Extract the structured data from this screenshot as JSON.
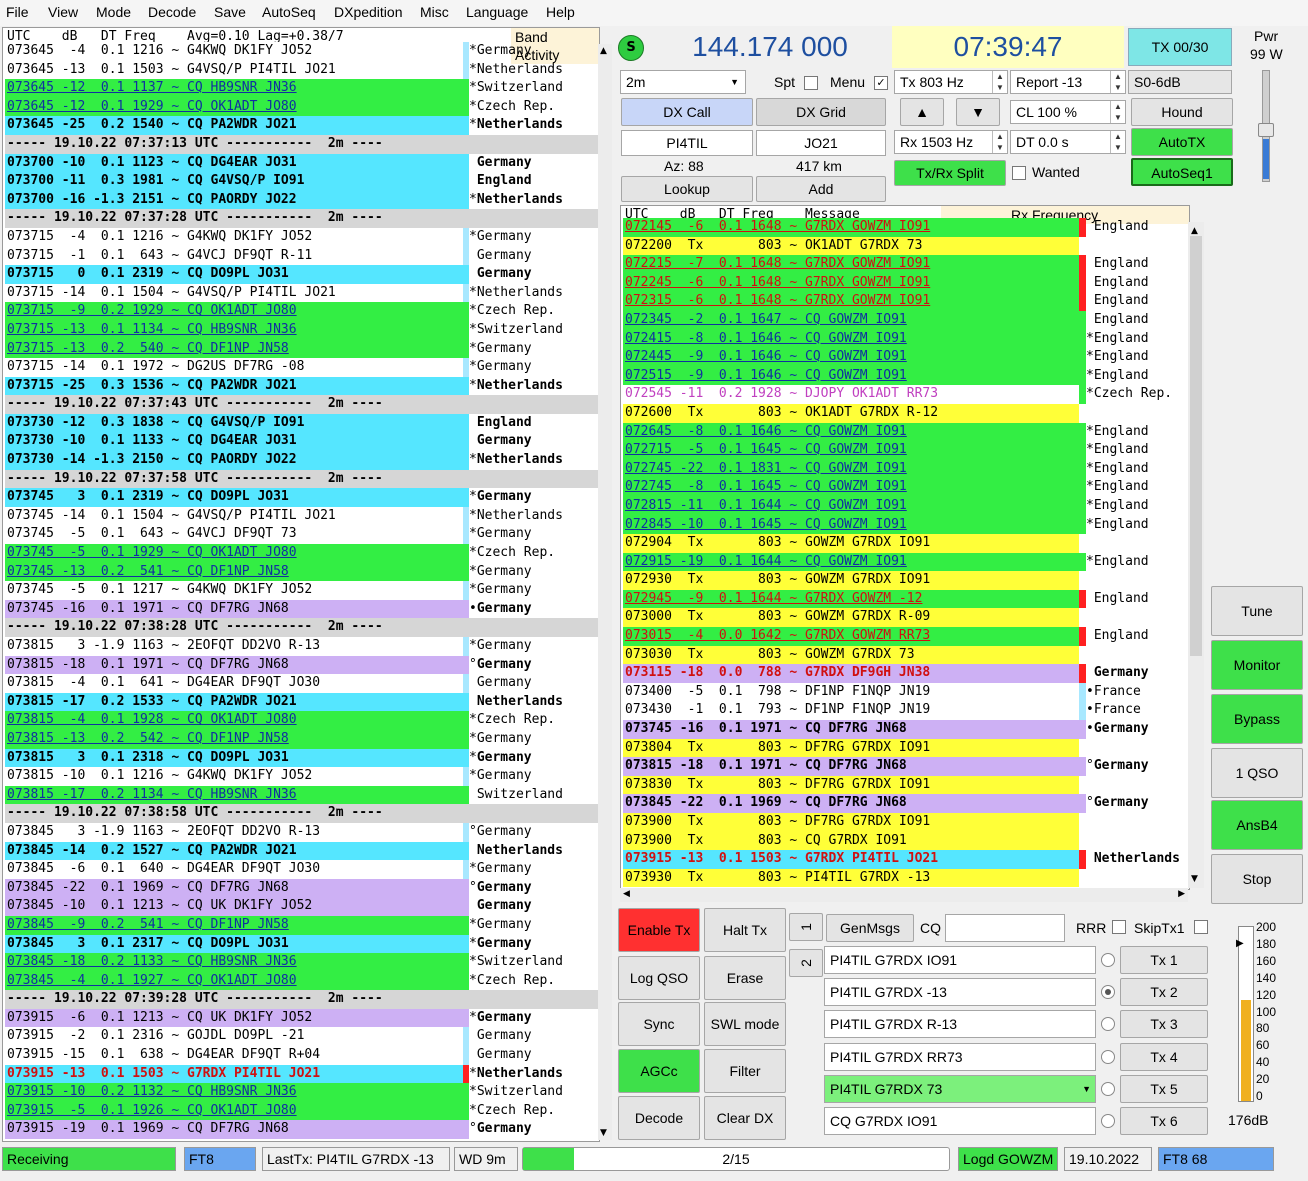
{
  "menu": [
    "File",
    "View",
    "Mode",
    "Decode",
    "Save",
    "AutoSeq",
    "DXpedition",
    "Misc",
    "Language",
    "Help"
  ],
  "colors": {
    "green": "#33ee44",
    "cyan": "#55e6ff",
    "purple": "#cdb0f4",
    "yellow": "#ffff38",
    "grayhdr": "#d6d6d6",
    "red": "#ff2020",
    "white": "#ffffff"
  },
  "band": {
    "header": "UTC    dB   DT Freq    Avg=0.10 Lag=+0.38/7",
    "title": "Band Activity",
    "rows": [
      [
        "073645  -4  0.1 1216 ~ G4KWQ DK1FY JO52",
        "Germany",
        "w",
        "*"
      ],
      [
        "073645 -13  0.1 1503 ~ G4VSQ/P PI4TIL JO21",
        "Netherlands",
        "w",
        "*"
      ],
      [
        "073645 -12  0.1 1137 ~ CQ HB9SNR JN36",
        "Switzerland",
        "g",
        "*"
      ],
      [
        "073645 -12  0.1 1929 ~ CQ OK1ADT JO80",
        "Czech Rep.",
        "g",
        "*"
      ],
      [
        "073645 -25  0.2 1540 ~ CQ PA2WDR JO21",
        "Netherlands",
        "c",
        "*"
      ],
      [
        "----- 19.10.22 07:37:13 UTC -----------  2m ----",
        "",
        "h",
        ""
      ],
      [
        "073700 -10  0.1 1123 ~ CQ DG4EAR JO31",
        "Germany",
        "c",
        " "
      ],
      [
        "073700 -11  0.3 1981 ~ CQ G4VSQ/P IO91",
        "England",
        "c",
        " "
      ],
      [
        "073700 -16 -1.3 2151 ~ CQ PAORDY JO22",
        "Netherlands",
        "c",
        "*"
      ],
      [
        "----- 19.10.22 07:37:28 UTC -----------  2m ----",
        "",
        "h",
        ""
      ],
      [
        "073715  -4  0.1 1216 ~ G4KWQ DK1FY JO52",
        "Germany",
        "w",
        "*"
      ],
      [
        "073715  -1  0.1  643 ~ G4VCJ DF9QT R-11",
        "Germany",
        "w",
        " "
      ],
      [
        "073715   0  0.1 2319 ~ CQ DO9PL JO31",
        "Germany",
        "c",
        " "
      ],
      [
        "073715 -14  0.1 1504 ~ G4VSQ/P PI4TIL JO21",
        "Netherlands",
        "w",
        "*"
      ],
      [
        "073715  -9  0.2 1929 ~ CQ OK1ADT JO80",
        "Czech Rep.",
        "g",
        "*"
      ],
      [
        "073715 -13  0.1 1134 ~ CQ HB9SNR JN36",
        "Switzerland",
        "g",
        "*"
      ],
      [
        "073715 -13  0.2  540 ~ CQ DF1NP JN58",
        "Germany",
        "g",
        "*"
      ],
      [
        "073715 -14  0.1 1972 ~ DG2US DF7RG -08",
        "Germany",
        "w",
        "*"
      ],
      [
        "073715 -25  0.3 1536 ~ CQ PA2WDR JO21",
        "Netherlands",
        "c",
        "*"
      ],
      [
        "----- 19.10.22 07:37:43 UTC -----------  2m ----",
        "",
        "h",
        ""
      ],
      [
        "073730 -12  0.3 1838 ~ CQ G4VSQ/P IO91",
        "England",
        "c",
        " "
      ],
      [
        "073730 -10  0.1 1133 ~ CQ DG4EAR JO31",
        "Germany",
        "c",
        " "
      ],
      [
        "073730 -14 -1.3 2150 ~ CQ PAORDY JO22",
        "Netherlands",
        "c",
        "*"
      ],
      [
        "----- 19.10.22 07:37:58 UTC -----------  2m ----",
        "",
        "h",
        ""
      ],
      [
        "073745   3  0.1 2319 ~ CQ DO9PL JO31",
        "Germany",
        "c",
        "*"
      ],
      [
        "073745 -14  0.1 1504 ~ G4VSQ/P PI4TIL JO21",
        "Netherlands",
        "w",
        "*"
      ],
      [
        "073745  -5  0.1  643 ~ G4VCJ DF9QT 73",
        "Germany",
        "w",
        "*"
      ],
      [
        "073745  -5  0.1 1929 ~ CQ OK1ADT JO80",
        "Czech Rep.",
        "g",
        "*"
      ],
      [
        "073745 -13  0.2  541 ~ CQ DF1NP JN58",
        "Germany",
        "g",
        "*"
      ],
      [
        "073745  -5  0.1 1217 ~ G4KWQ DK1FY JO52",
        "Germany",
        "w",
        "*"
      ],
      [
        "073745 -16  0.1 1971 ~ CQ DF7RG JN68",
        "Germany",
        "p",
        "•"
      ],
      [
        "----- 19.10.22 07:38:28 UTC -----------  2m ----",
        "",
        "h",
        ""
      ],
      [
        "073815   3 -1.9 1163 ~ 2EOFQT DD2VO R-13",
        "Germany",
        "w",
        "*"
      ],
      [
        "073815 -18  0.1 1971 ~ CQ DF7RG JN68",
        "Germany",
        "p",
        "°"
      ],
      [
        "073815  -4  0.1  641 ~ DG4EAR DF9QT JO30",
        "Germany",
        "w",
        " "
      ],
      [
        "073815 -17  0.2 1533 ~ CQ PA2WDR JO21",
        "Netherlands",
        "c",
        " "
      ],
      [
        "073815  -4  0.1 1928 ~ CQ OK1ADT JO80",
        "Czech Rep.",
        "g",
        "*"
      ],
      [
        "073815 -13  0.2  542 ~ CQ DF1NP JN58",
        "Germany",
        "g",
        "*"
      ],
      [
        "073815   3  0.1 2318 ~ CQ DO9PL JO31",
        "Germany",
        "c",
        "*"
      ],
      [
        "073815 -10  0.1 1216 ~ G4KWQ DK1FY JO52",
        "Germany",
        "w",
        "*"
      ],
      [
        "073815 -17  0.2 1134 ~ CQ HB9SNR JN36",
        "Switzerland",
        "g",
        " "
      ],
      [
        "----- 19.10.22 07:38:58 UTC -----------  2m ----",
        "",
        "h",
        ""
      ],
      [
        "073845   3 -1.9 1163 ~ 2EOFQT DD2VO R-13",
        "Germany",
        "w",
        "°"
      ],
      [
        "073845 -14  0.2 1527 ~ CQ PA2WDR JO21",
        "Netherlands",
        "c",
        " "
      ],
      [
        "073845  -6  0.1  640 ~ DG4EAR DF9QT JO30",
        "Germany",
        "w",
        "*"
      ],
      [
        "073845 -22  0.1 1969 ~ CQ DF7RG JN68",
        "Germany",
        "p",
        "°"
      ],
      [
        "073845 -10  0.1 1213 ~ CQ UK DK1FY JO52",
        "Germany",
        "p",
        " "
      ],
      [
        "073845  -9  0.2  541 ~ CQ DF1NP JN58",
        "Germany",
        "g",
        "*"
      ],
      [
        "073845   3  0.1 2317 ~ CQ DO9PL JO31",
        "Germany",
        "c",
        "*"
      ],
      [
        "073845 -18  0.2 1133 ~ CQ HB9SNR JN36",
        "Switzerland",
        "g",
        "*"
      ],
      [
        "073845  -4  0.1 1927 ~ CQ OK1ADT JO80",
        "Czech Rep.",
        "g",
        "*"
      ],
      [
        "----- 19.10.22 07:39:28 UTC -----------  2m ----",
        "",
        "h",
        ""
      ],
      [
        "073915  -6  0.1 1213 ~ CQ UK DK1FY JO52",
        "Germany",
        "p",
        "*"
      ],
      [
        "073915  -2  0.1 2316 ~ GOJDL DO9PL -21",
        "Germany",
        "w",
        " "
      ],
      [
        "073915 -15  0.1  638 ~ DG4EAR DF9QT R+04",
        "Germany",
        "w",
        " "
      ],
      [
        "073915 -13  0.1 1503 ~ G7RDX PI4TIL JO21",
        "Netherlands",
        "c",
        "*"
      ],
      [
        "073915 -10  0.2 1132 ~ CQ HB9SNR JN36",
        "Switzerland",
        "g",
        "*"
      ],
      [
        "073915  -5  0.1 1926 ~ CQ OK1ADT JO80",
        "Czech Rep.",
        "g",
        "*"
      ],
      [
        "073915 -19  0.1 1969 ~ CQ DF7RG JN68",
        "Germany",
        "p",
        "°"
      ]
    ]
  },
  "top": {
    "s_icon": "S",
    "freq": "144.174 000",
    "clock": "07:39:47",
    "tx_count": "TX 00/30",
    "pwr_label": "Pwr",
    "pwr_value": "99 W",
    "band": "2m",
    "spt": "Spt",
    "menu_chk": "Menu",
    "tx_hz": "Tx  803  Hz",
    "report": "Report -13",
    "s0": "S0-6dB",
    "dxcall_label": "DX Call",
    "dxgrid_label": "DX Grid",
    "up": "▲",
    "down": "▼",
    "cl": "CL  100 %",
    "hound": "Hound",
    "dxcall": "PI4TIL",
    "dxgrid": "JO21",
    "rx_hz": "Rx  1503  Hz",
    "dt": "DT 0.0 s",
    "autotx": "AutoTX",
    "az": "Az: 88",
    "km": "417 km",
    "txrx": "Tx/Rx Split",
    "wanted": "Wanted",
    "autoseq": "AutoSeq1",
    "lookup": "Lookup",
    "add": "Add"
  },
  "rx": {
    "header": "UTC    dB   DT Freq    Message",
    "title": "Rx Frequency",
    "rows": [
      [
        "072145  -6  0.1 1648 ~ G7RDX GOWZM IO91",
        "England",
        "g",
        "r"
      ],
      [
        "072200  Tx       803 ~ OK1ADT G7RDX 73",
        "",
        "y",
        ""
      ],
      [
        "072215  -7  0.1 1648 ~ G7RDX GOWZM IO91",
        "England",
        "g",
        "r"
      ],
      [
        "072245  -6  0.1 1648 ~ G7RDX GOWZM IO91",
        "England",
        "g",
        "r"
      ],
      [
        "072315  -6  0.1 1648 ~ G7RDX GOWZM IO91",
        "England",
        "g",
        "r"
      ],
      [
        "072345  -2  0.1 1647 ~ CQ GOWZM IO91",
        "England",
        "g",
        " "
      ],
      [
        "072415  -8  0.1 1646 ~ CQ GOWZM IO91",
        "England",
        "g",
        "*"
      ],
      [
        "072445  -9  0.1 1646 ~ CQ GOWZM IO91",
        "England",
        "g",
        "*"
      ],
      [
        "072515  -9  0.1 1646 ~ CQ GOWZM IO91",
        "England",
        "g",
        "*"
      ],
      [
        "072545 -11  0.2 1928 ~ DJOPY OK1ADT RR73",
        "Czech Rep.",
        "m",
        "*"
      ],
      [
        "072600  Tx       803 ~ OK1ADT G7RDX R-12",
        "",
        "y",
        ""
      ],
      [
        "072645  -8  0.1 1646 ~ CQ GOWZM IO91",
        "England",
        "g",
        "*"
      ],
      [
        "072715  -5  0.1 1645 ~ CQ GOWZM IO91",
        "England",
        "g",
        "*"
      ],
      [
        "072745 -22  0.1 1831 ~ CQ GOWZM IO91",
        "England",
        "g",
        "*"
      ],
      [
        "072745  -8  0.1 1645 ~ CQ GOWZM IO91",
        "England",
        "g",
        "*"
      ],
      [
        "072815 -11  0.1 1644 ~ CQ GOWZM IO91",
        "England",
        "g",
        "*"
      ],
      [
        "072845 -10  0.1 1645 ~ CQ GOWZM IO91",
        "England",
        "g",
        "*"
      ],
      [
        "072904  Tx       803 ~ GOWZM G7RDX IO91",
        "",
        "y",
        ""
      ],
      [
        "072915 -19  0.1 1644 ~ CQ GOWZM IO91",
        "England",
        "g",
        "*"
      ],
      [
        "072930  Tx       803 ~ GOWZM G7RDX IO91",
        "",
        "y",
        ""
      ],
      [
        "072945  -9  0.1 1644 ~ G7RDX GOWZM -12",
        "England",
        "g",
        "r"
      ],
      [
        "073000  Tx       803 ~ GOWZM G7RDX R-09",
        "",
        "y",
        ""
      ],
      [
        "073015  -4  0.0 1642 ~ G7RDX GOWZM RR73",
        "England",
        "g",
        "r"
      ],
      [
        "073030  Tx       803 ~ GOWZM G7RDX 73",
        "",
        "y",
        ""
      ],
      [
        "073115 -18  0.0  788 ~ G7RDX DF9GH JN38",
        "Germany",
        "pr",
        "r"
      ],
      [
        "073400  -5  0.1  798 ~ DF1NP F1NQP JN19",
        "France",
        "w",
        "•"
      ],
      [
        "073430  -1  0.1  793 ~ DF1NP F1NQP JN19",
        "France",
        "w",
        "•"
      ],
      [
        "073745 -16  0.1 1971 ~ CQ DF7RG JN68",
        "Germany",
        "p",
        "•"
      ],
      [
        "073804  Tx       803 ~ DF7RG G7RDX IO91",
        "",
        "y",
        ""
      ],
      [
        "073815 -18  0.1 1971 ~ CQ DF7RG JN68",
        "Germany",
        "p",
        "°"
      ],
      [
        "073830  Tx       803 ~ DF7RG G7RDX IO91",
        "",
        "y",
        ""
      ],
      [
        "073845 -22  0.1 1969 ~ CQ DF7RG JN68",
        "Germany",
        "p",
        "°"
      ],
      [
        "073900  Tx       803 ~ DF7RG G7RDX IO91",
        "",
        "y",
        ""
      ],
      [
        "073900  Tx       803 ~ CQ G7RDX IO91",
        "",
        "y",
        ""
      ],
      [
        "073915 -13  0.1 1503 ~ G7RDX PI4TIL JO21",
        "Netherlands",
        "c",
        "r"
      ],
      [
        "073930  Tx       803 ~ PI4TIL G7RDX -13",
        "",
        "y",
        ""
      ]
    ]
  },
  "controls": {
    "enable_tx": "Enable Tx",
    "halt_tx": "Halt Tx",
    "log_qso": "Log QSO",
    "erase": "Erase",
    "sync": "Sync",
    "swl": "SWL mode",
    "agcc": "AGCc",
    "filter": "Filter",
    "decode": "Decode",
    "clear_dx": "Clear DX",
    "tab1": "1",
    "tab2": "2",
    "genmsgs": "GenMsgs",
    "cq": "CQ",
    "rrr": "RRR",
    "skiptx1": "SkipTx1",
    "msgs": [
      "PI4TIL G7RDX IO91",
      "PI4TIL G7RDX -13",
      "PI4TIL G7RDX R-13",
      "PI4TIL G7RDX RR73",
      "PI4TIL G7RDX 73",
      "CQ G7RDX IO91"
    ],
    "txs": [
      "Tx 1",
      "Tx 2",
      "Tx 3",
      "Tx 4",
      "Tx 5",
      "Tx 6"
    ]
  },
  "right_btns": {
    "tune": "Tune",
    "monitor": "Monitor",
    "bypass": "Bypass",
    "qso": "1 QSO",
    "ansb4": "AnsB4",
    "stop": "Stop"
  },
  "level": {
    "ticks": [
      "200",
      "180",
      "160",
      "140",
      "120",
      "100",
      "80",
      "60",
      "40",
      "20",
      "0"
    ],
    "db": "176dB",
    "level_pct": 58
  },
  "status": {
    "receiving": "Receiving",
    "mode": "FT8",
    "lasttx": "LastTx: PI4TIL G7RDX -13",
    "wd": "WD 9m",
    "progress": "2/15",
    "progress_pct": 12,
    "logd": "Logd GOWZM",
    "date": "19.10.2022",
    "ft8n": "FT8  68"
  }
}
